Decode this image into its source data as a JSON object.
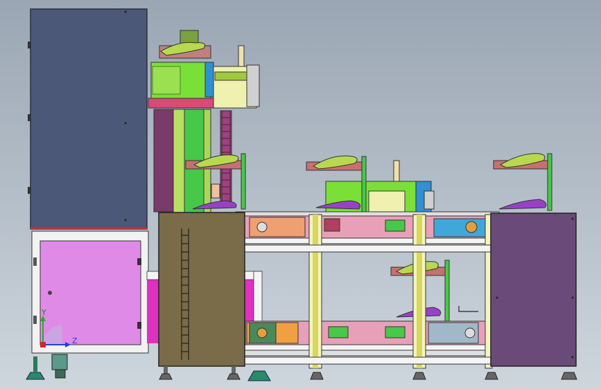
{
  "viewport": {
    "background_top": "#9aa6b3",
    "background_bottom": "#ced6dd",
    "colors": {
      "cabinet_blue": "#4c5878",
      "cabinet_olive": "#7a6b49",
      "cabinet_purple": "#6a4a78",
      "panel_pink": "#e08ae8",
      "magenta": "#e030c0",
      "frame_yellow": "#d8d860",
      "frame_green": "#48c848",
      "belt_pink": "#e8a0b8",
      "shoe_green": "#b8d850",
      "shoe_purple": "#9a40c8",
      "orange_plate": "#f0a070",
      "cyan_motor": "#40a8d8"
    }
  },
  "triad": {
    "y_label": "Y",
    "z_label": "Z",
    "x_color": "#e02020",
    "y_color": "#20b020",
    "z_color": "#2040e0"
  }
}
